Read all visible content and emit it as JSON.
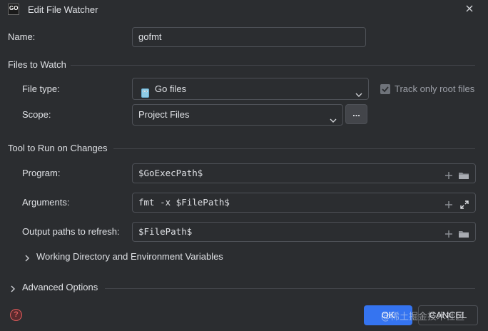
{
  "window": {
    "title": "Edit File Watcher",
    "app_icon_text": "GO"
  },
  "name_field": {
    "label": "Name:",
    "value": "gofmt"
  },
  "files_to_watch": {
    "section_title": "Files to Watch",
    "file_type": {
      "label": "File type:",
      "value": "Go files",
      "icon": "go-file-icon"
    },
    "track_only_root": {
      "label": "Track only root files",
      "checked": true
    },
    "scope": {
      "label": "Scope:",
      "value": "Project Files",
      "browse_label": "..."
    }
  },
  "tool_to_run": {
    "section_title": "Tool to Run on Changes",
    "program": {
      "label": "Program:",
      "value": "$GoExecPath$"
    },
    "arguments": {
      "label": "Arguments:",
      "value": "fmt -x $FilePath$"
    },
    "output_paths": {
      "label": "Output paths to refresh:",
      "value": "$FilePath$"
    },
    "working_dir_toggle": "Working Directory and Environment Variables"
  },
  "advanced_options": {
    "label": "Advanced Options"
  },
  "footer": {
    "ok_label": "OK",
    "cancel_label": "CANCEL",
    "watermark": "@稀土掘金技术社区"
  },
  "colors": {
    "background": "#2b2d30",
    "field_border": "#4e5157",
    "primary_button": "#3574f0",
    "help_icon": "#db5c5c"
  }
}
